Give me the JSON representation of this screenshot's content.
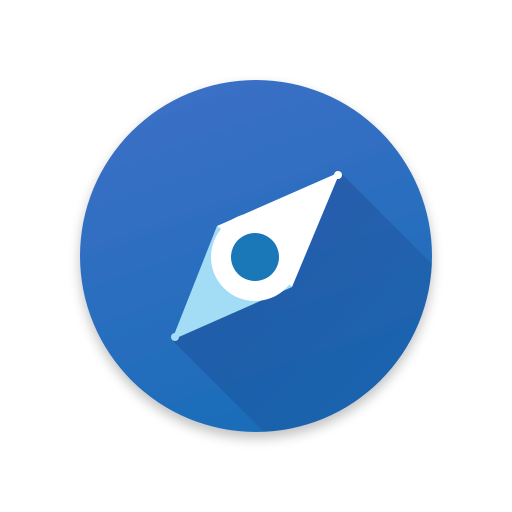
{
  "icon": {
    "name": "compass-app-icon",
    "colors": {
      "background": "#ffffff",
      "circle_top": "#3F6FC7",
      "circle_bottom": "#1E6CB8",
      "long_shadow": "#1A4F93",
      "needle_north": "#ffffff",
      "needle_south": "#A3DCF5",
      "hub_ring": "#ffffff",
      "hub_center": "#1A78B8"
    }
  }
}
